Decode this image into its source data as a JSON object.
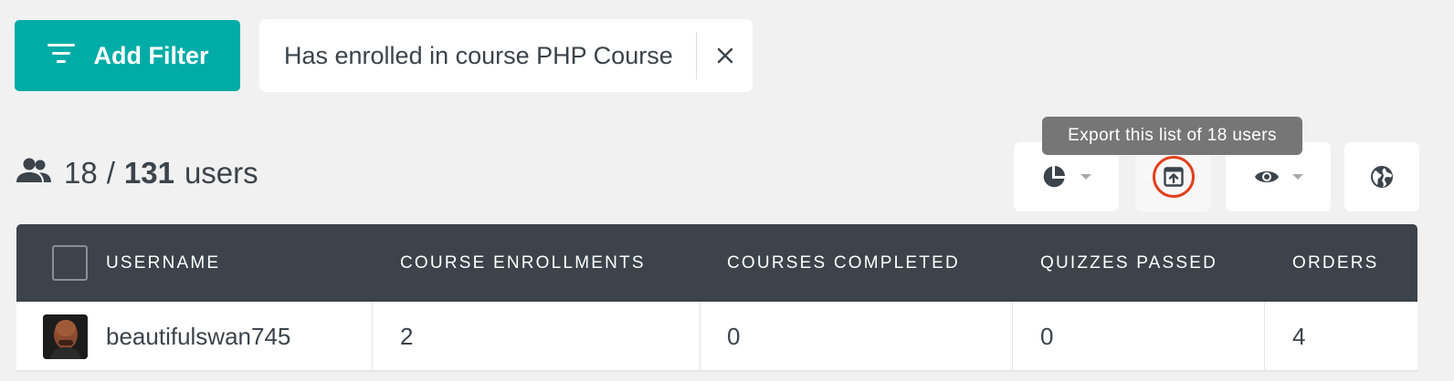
{
  "filter_bar": {
    "add_filter_label": "Add Filter",
    "active_filter": "Has enrolled in course PHP Course",
    "icons": {
      "add_filter": "filter-lines-icon",
      "remove_filter": "close-icon"
    }
  },
  "summary": {
    "icon": "users-icon",
    "shown": "18",
    "separator": "/",
    "total": "131",
    "unit": "users"
  },
  "toolbar": {
    "buttons": [
      {
        "icon": "pie-chart-icon",
        "has_dropdown": true
      },
      {
        "icon": "export-icon",
        "highlighted": true
      },
      {
        "icon": "eye-icon",
        "has_dropdown": true
      },
      {
        "icon": "globe-icon"
      }
    ],
    "tooltip": "Export this list of 18 users"
  },
  "table": {
    "columns": [
      "USERNAME",
      "COURSE ENROLLMENTS",
      "COURSES COMPLETED",
      "QUIZZES PASSED",
      "ORDERS"
    ],
    "rows": [
      {
        "username": "beautifulswan745",
        "course_enrollments": "2",
        "courses_completed": "0",
        "quizzes_passed": "0",
        "orders": "4"
      }
    ]
  },
  "colors": {
    "accent": "#00aca6",
    "header_bg": "#3c434a",
    "highlight_ring": "#e2401c",
    "tooltip_bg": "#767676",
    "page_bg": "#f1f1f1"
  }
}
